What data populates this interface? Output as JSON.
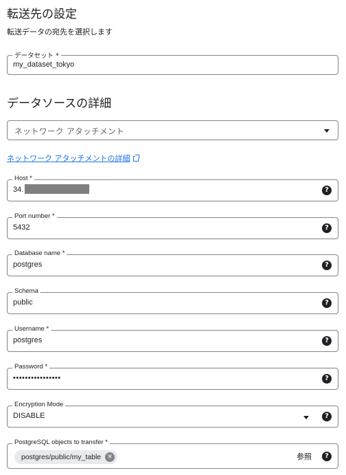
{
  "destination": {
    "title": "転送先の設定",
    "subtitle": "転送データの宛先を選択します",
    "dataset_label": "データセット *",
    "dataset_value": "my_dataset_tokyo"
  },
  "source": {
    "title": "データソースの詳細",
    "network_attachment_placeholder": "ネットワーク アタッチメント",
    "network_attachment_link": "ネットワーク アタッチメントの詳細"
  },
  "fields": {
    "host": {
      "label": "Host *",
      "value": "34."
    },
    "port": {
      "label": "Port number *",
      "value": "5432"
    },
    "database": {
      "label": "Database name *",
      "value": "postgres"
    },
    "schema": {
      "label": "Schema",
      "value": "public"
    },
    "username": {
      "label": "Username *",
      "value": "postgres"
    },
    "password": {
      "label": "Password *",
      "value": "••••••••••••••••"
    },
    "encryption": {
      "label": "Encryption Mode",
      "value": "DISABLE"
    },
    "objects": {
      "label": "PostgreSQL objects to transfer *",
      "chip": "postgres/public/my_table",
      "browse": "参照"
    }
  },
  "icons": {
    "help": "help-icon",
    "dropdown": "dropdown-caret-icon",
    "external_link": "external-link-icon",
    "chip_remove": "chip-remove-icon"
  },
  "colors": {
    "link": "#1a73e8",
    "border": "#80868b",
    "chip_bg": "#e8eaed",
    "text": "#202124"
  }
}
